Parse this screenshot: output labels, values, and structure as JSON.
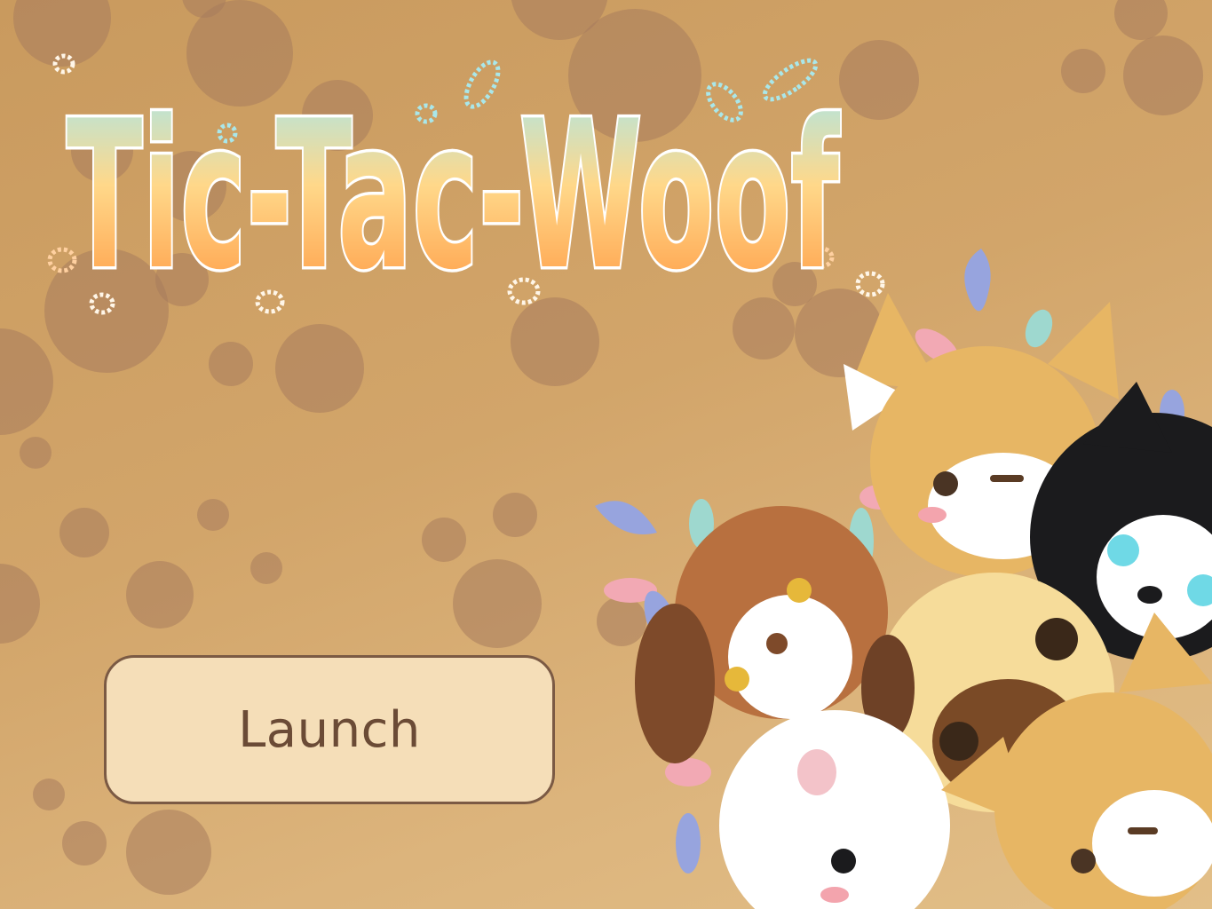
{
  "game": {
    "title": "Tic-Tac-Woof",
    "launch_label": "Launch"
  },
  "colors": {
    "background": "#d2a56a",
    "paw_print": "#a87c5c",
    "button_fill": "#f5deb8",
    "button_border": "#7b5a44",
    "button_text": "#6b4b36",
    "title_top": "#a8e6ea",
    "title_mid": "#ffd27a",
    "title_bottom": "#ff9a45"
  },
  "icons": [
    "paw-print-icon",
    "splash-icon",
    "dog-icon"
  ]
}
